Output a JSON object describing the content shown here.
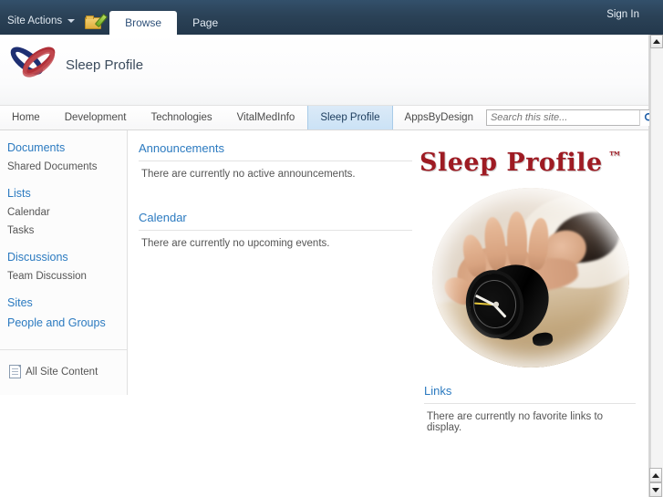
{
  "ribbon": {
    "site_actions_label": "Site Actions",
    "nav_up_icon": "navigate-up-folder-pencil-icon",
    "tabs": [
      {
        "label": "Browse",
        "active": true
      },
      {
        "label": "Page",
        "active": false
      }
    ],
    "sign_in_label": "Sign In"
  },
  "site_header": {
    "logo_icon": "interlocking-rings-logo",
    "title": "Sleep Profile"
  },
  "topnav": {
    "items": [
      {
        "label": "Home",
        "active": false
      },
      {
        "label": "Development",
        "active": false
      },
      {
        "label": "Technologies",
        "active": false
      },
      {
        "label": "VitalMedInfo",
        "active": false
      },
      {
        "label": "Sleep Profile",
        "active": true
      },
      {
        "label": "AppsByDesign",
        "active": false
      }
    ],
    "search": {
      "placeholder": "Search this site...",
      "value": "",
      "icon": "search-icon"
    },
    "help_icon": "help-question-icon",
    "help_glyph": "?"
  },
  "sidebar": {
    "groups": [
      {
        "header": "Documents",
        "items": [
          {
            "label": "Shared Documents",
            "style": "plain"
          }
        ]
      },
      {
        "header": "Lists",
        "items": [
          {
            "label": "Calendar",
            "style": "plain"
          },
          {
            "label": "Tasks",
            "style": "plain"
          }
        ]
      },
      {
        "header": "Discussions",
        "items": [
          {
            "label": "Team Discussion",
            "style": "plain"
          }
        ]
      },
      {
        "header": "Sites",
        "items": [
          {
            "label": "People and Groups",
            "style": "link"
          }
        ]
      }
    ],
    "all_site_content": {
      "label": "All Site Content",
      "icon": "document-icon"
    }
  },
  "main": {
    "webparts": [
      {
        "title": "Announcements",
        "empty_text": "There are currently no active announcements."
      },
      {
        "title": "Calendar",
        "empty_text": "There are currently no upcoming events."
      }
    ],
    "branding": {
      "title": "Sleep Profile",
      "trademark": "™",
      "color": "#9e1b23",
      "photo_alt": "person in bed reaching for black alarm clock"
    },
    "links_webpart": {
      "title": "Links",
      "empty_text": "There are currently no favorite links to display."
    }
  },
  "scrollbars": {
    "outer_up_icon": "scroll-up-arrow-icon",
    "inner_up_icon": "scroll-up-arrow-icon",
    "inner_down_icon": "scroll-down-arrow-icon"
  }
}
